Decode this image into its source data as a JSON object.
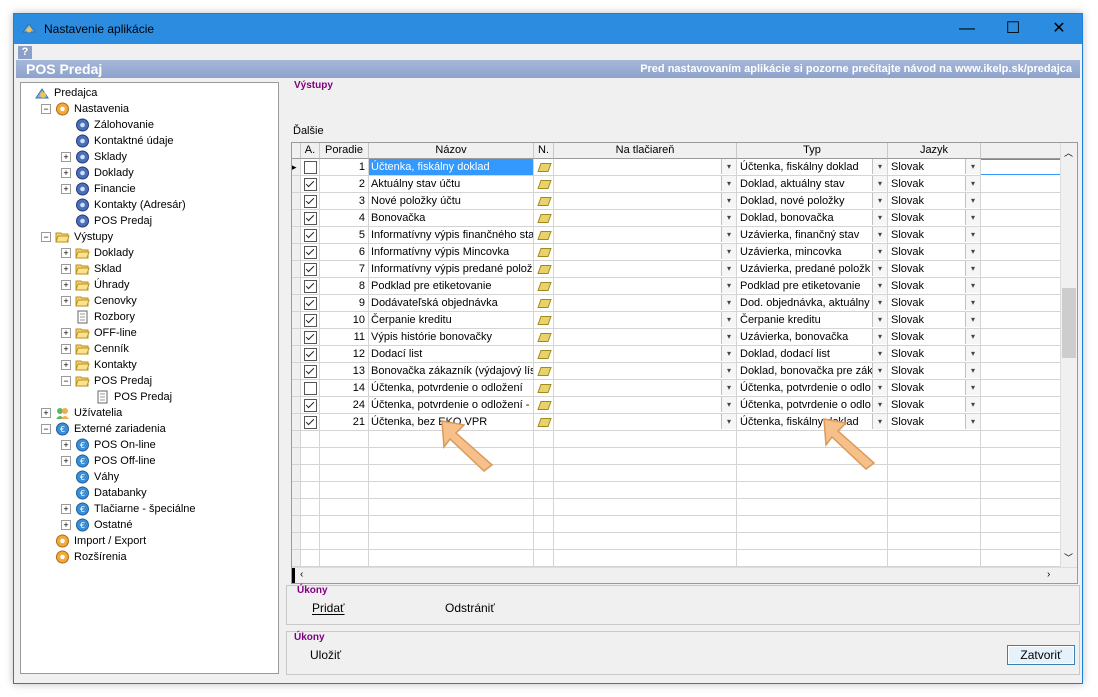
{
  "window": {
    "title": "Nastavenie aplikácie",
    "help_glyph": "?",
    "header_title": "POS Predaj",
    "header_note": "Pred nastavovaním aplikácie si pozorne prečítajte návod na www.ikelp.sk/predajca",
    "controls": {
      "minimize": "—",
      "maximize": "☐",
      "close": "✕"
    }
  },
  "tree": [
    {
      "label": "Predajca",
      "icon": "app-icon",
      "level": 0,
      "expander": ""
    },
    {
      "label": "Nastavenia",
      "icon": "gear-orange-icon",
      "level": 1,
      "expander": "−"
    },
    {
      "label": "Zálohovanie",
      "icon": "gear-blue-icon",
      "level": 2,
      "expander": ""
    },
    {
      "label": "Kontaktné údaje",
      "icon": "gear-blue-icon",
      "level": 2,
      "expander": ""
    },
    {
      "label": "Sklady",
      "icon": "gear-blue-icon",
      "level": 2,
      "expander": "+"
    },
    {
      "label": "Doklady",
      "icon": "gear-blue-icon",
      "level": 2,
      "expander": "+"
    },
    {
      "label": "Financie",
      "icon": "gear-blue-icon",
      "level": 2,
      "expander": "+"
    },
    {
      "label": "Kontakty (Adresár)",
      "icon": "gear-blue-icon",
      "level": 2,
      "expander": ""
    },
    {
      "label": "POS Predaj",
      "icon": "gear-blue-icon",
      "level": 2,
      "expander": ""
    },
    {
      "label": "Výstupy",
      "icon": "folder-open-icon",
      "level": 1,
      "expander": "−"
    },
    {
      "label": "Doklady",
      "icon": "folder-open-icon",
      "level": 2,
      "expander": "+"
    },
    {
      "label": "Sklad",
      "icon": "folder-open-icon",
      "level": 2,
      "expander": "+"
    },
    {
      "label": "Úhrady",
      "icon": "folder-open-icon",
      "level": 2,
      "expander": "+"
    },
    {
      "label": "Cenovky",
      "icon": "folder-open-icon",
      "level": 2,
      "expander": "+"
    },
    {
      "label": "Rozbory",
      "icon": "document-icon",
      "level": 2,
      "expander": ""
    },
    {
      "label": "OFF-line",
      "icon": "folder-open-icon",
      "level": 2,
      "expander": "+"
    },
    {
      "label": "Cenník",
      "icon": "folder-open-icon",
      "level": 2,
      "expander": "+"
    },
    {
      "label": "Kontakty",
      "icon": "folder-open-icon",
      "level": 2,
      "expander": "+"
    },
    {
      "label": "POS Predaj",
      "icon": "folder-open-icon",
      "level": 2,
      "expander": "−"
    },
    {
      "label": "POS Predaj",
      "icon": "document-icon",
      "level": 3,
      "expander": ""
    },
    {
      "label": "Užívatelia",
      "icon": "users-icon",
      "level": 1,
      "expander": "+"
    },
    {
      "label": "Externé zariadenia",
      "icon": "euro-icon",
      "level": 1,
      "expander": "−"
    },
    {
      "label": "POS On-line",
      "icon": "euro-icon",
      "level": 2,
      "expander": "+"
    },
    {
      "label": "POS Off-line",
      "icon": "euro-icon",
      "level": 2,
      "expander": "+"
    },
    {
      "label": "Váhy",
      "icon": "euro-icon",
      "level": 2,
      "expander": ""
    },
    {
      "label": "Databanky",
      "icon": "euro-icon",
      "level": 2,
      "expander": ""
    },
    {
      "label": "Tlačiarne - špeciálne",
      "icon": "euro-icon",
      "level": 2,
      "expander": "+"
    },
    {
      "label": "Ostatné",
      "icon": "euro-icon",
      "level": 2,
      "expander": "+"
    },
    {
      "label": "Import / Export",
      "icon": "gear-orange-icon",
      "level": 1,
      "expander": ""
    },
    {
      "label": "Rozšírenia",
      "icon": "gear-orange-icon",
      "level": 1,
      "expander": ""
    }
  ],
  "main": {
    "vystupy_title": "Výstupy",
    "dalsie_label": "Ďalšie",
    "columns": [
      "A.",
      "Poradie",
      "Názov",
      "N.",
      "Na tlačiareň",
      "Typ",
      "Jazyk"
    ],
    "rows": [
      {
        "active": false,
        "order": "1",
        "name": "Účtenka, fiskálny doklad",
        "printer": "",
        "type": "Účtenka, fiskálny doklad",
        "lang": "Slovak",
        "selected": true
      },
      {
        "active": true,
        "order": "2",
        "name": "Aktuálny stav účtu",
        "printer": "",
        "type": "Doklad, aktuálny stav",
        "lang": "Slovak"
      },
      {
        "active": true,
        "order": "3",
        "name": "Nové položky účtu",
        "printer": "",
        "type": "Doklad, nové položky",
        "lang": "Slovak"
      },
      {
        "active": true,
        "order": "4",
        "name": "Bonovačka",
        "printer": "",
        "type": "Doklad, bonovačka",
        "lang": "Slovak"
      },
      {
        "active": true,
        "order": "5",
        "name": "Informatívny výpis finančného sta",
        "printer": "",
        "type": "Uzávierka, finančný stav",
        "lang": "Slovak"
      },
      {
        "active": true,
        "order": "6",
        "name": "Informatívny výpis Mincovka",
        "printer": "",
        "type": "Uzávierka, mincovka",
        "lang": "Slovak"
      },
      {
        "active": true,
        "order": "7",
        "name": "Informatívny výpis predané položi",
        "printer": "",
        "type": "Uzávierka, predané položk",
        "lang": "Slovak"
      },
      {
        "active": true,
        "order": "8",
        "name": "Podklad pre etiketovanie",
        "printer": "",
        "type": "Podklad pre etiketovanie",
        "lang": "Slovak"
      },
      {
        "active": true,
        "order": "9",
        "name": "Dodávateľská objednávka",
        "printer": "",
        "type": "Dod. objednávka, aktuálny",
        "lang": "Slovak"
      },
      {
        "active": true,
        "order": "10",
        "name": "Čerpanie kreditu",
        "printer": "",
        "type": "Čerpanie kreditu",
        "lang": "Slovak"
      },
      {
        "active": true,
        "order": "11",
        "name": "Výpis histórie bonovačky",
        "printer": "",
        "type": "Uzávierka, bonovačka",
        "lang": "Slovak"
      },
      {
        "active": true,
        "order": "12",
        "name": "Dodací list",
        "printer": "",
        "type": "Doklad, dodací list",
        "lang": "Slovak"
      },
      {
        "active": true,
        "order": "13",
        "name": "Bonovačka zákazník (výdajový lís",
        "printer": "",
        "type": "Doklad, bonovačka pre zák",
        "lang": "Slovak"
      },
      {
        "active": false,
        "order": "14",
        "name": "Účtenka, potvrdenie o odložení",
        "printer": "",
        "type": "Účtenka, potvrdenie o odlo",
        "lang": "Slovak"
      },
      {
        "active": true,
        "order": "24",
        "name": "Účtenka, potvrdenie o odložení - p",
        "printer": "",
        "type": "Účtenka, potvrdenie o odlo",
        "lang": "Slovak"
      },
      {
        "active": true,
        "order": "21",
        "name": "Účtenka, bez EKO VPR",
        "printer": "",
        "type": "Účtenka, fiskálny doklad",
        "lang": "Slovak"
      }
    ],
    "ukony1_title": "Úkony",
    "add_label": "Pridať",
    "remove_label": "Odstrániť",
    "ukony2_title": "Úkony",
    "save_label": "Uložiť",
    "close_label": "Zatvoriť"
  },
  "colors": {
    "titlebar": "#2b8ce0",
    "header": "#8da2cc",
    "group_title": "#800080",
    "selection": "#3399ff",
    "arrow": "#f7c08a"
  }
}
